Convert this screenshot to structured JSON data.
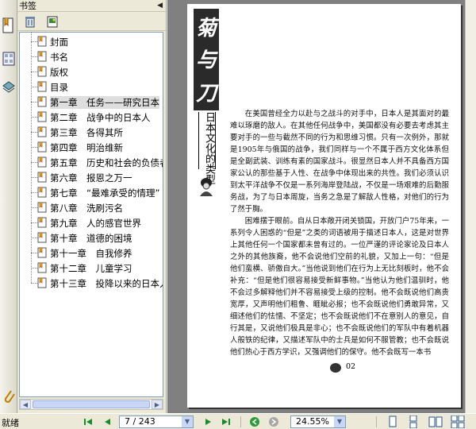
{
  "panel": {
    "title": "书签",
    "collapse_glyph": "◀"
  },
  "bookmarks": [
    {
      "label": "封面"
    },
    {
      "label": "书名"
    },
    {
      "label": "版权"
    },
    {
      "label": "目录"
    },
    {
      "label": "第一章　任务——研究日本"
    },
    {
      "label": "第二章　战争中的日本人"
    },
    {
      "label": "第三章　各得其所"
    },
    {
      "label": "第四章　明治维新"
    },
    {
      "label": "第五章　历史和社会的负债者"
    },
    {
      "label": "第六章　报恩之万一"
    },
    {
      "label": "第七章　“最难承受的情理”"
    },
    {
      "label": "第八章　洗刷污名"
    },
    {
      "label": "第九章　人的感官世界"
    },
    {
      "label": "第十章　道德的困境"
    },
    {
      "label": "第十一章　自我修养"
    },
    {
      "label": "第十二章　儿童学习"
    },
    {
      "label": "第十三章　投降以来的日本人"
    }
  ],
  "selected_bookmark_index": 4,
  "page": {
    "banner_chars": [
      "菊",
      "与",
      "刀"
    ],
    "vertical_title": "日本文化的类型",
    "paragraphs": [
      "在美国曾经全力以赴与之战斗的对手中，日本人是其面对的最难以琢磨的敌人。在其他任何战争中，美国都没有必要去考虑其主要对手的一些与截然不同的行为和思维习惯。只有一次例外，那就是1905年与俄国的战争，我们同样与一个不属于西方文化体系但是全副武装、训练有素的国家战斗。很显然日本人并不具备西方国家公认的那些基于人性、在战争中体现出来的共性。我们必须认识到太平洋战争不仅是一系列海岸登陆战，不仅是一场艰难的后勤服务战，为了与日本周旋，当务之急是了解敌人性格，对他们的行为了然于胸。",
      "困难摆于眼前。自从日本敞开闭关锁国，开放门户75年来，一系列令人困惑的“但是”之类的词语被用于描述日本人，这是对世界上其他任何一个国家都未曾有过的。一位严谨的评论家论及日本人之外的其他族裔，他不会说他们空前的礼貌，又加上一句：“但是他们蛮横、骄傲自大。”当他说到他们在行为上无比刻板时，他不会补充：“但是他们很容易接受新鲜事物。”当他认为他们温驯时，他不会过多解释他们并不容易接受上级的控制。他不会既说他们高贵宽厚，又声明他们粗鲁、睚眦必报；也不会既说他们勇敢异常，又细述他们的怯懦、不坚定；也不会既说他们不在意别人的意见，自行其是，又说他们极具是非心；也不会既说他们的军队中有着机器人般铁的纪律，又描述军队中的士兵是如何不服管教；也不会既说他们热心于西方学识，又强调他们的保守。他不会既写一本书"
    ],
    "page_number": "02"
  },
  "status": {
    "ready_text": "就绪",
    "page_field": "7 / 243",
    "zoom_field": "24.55%"
  }
}
